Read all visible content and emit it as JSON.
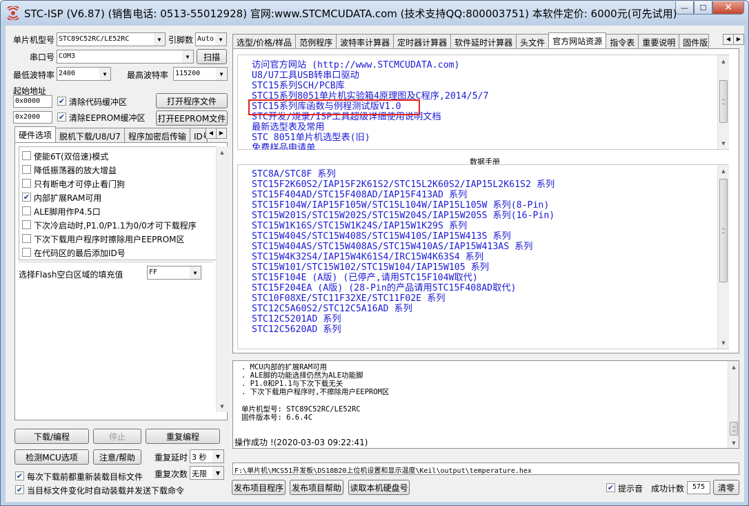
{
  "window": {
    "title": "STC-ISP (V6.87) (销售电话: 0513-55012928) 官网:www.STCMCUDATA.com  (技术支持QQ:800003751) 本软件定价: 6000元(可先试用)",
    "minimize": "—",
    "maximize": "☐",
    "close": "✕"
  },
  "left": {
    "mcu_type_label": "单片机型号",
    "mcu_type_value": "STC89C52RC/LE52RC",
    "pin_count_label": "引脚数",
    "pin_count_value": "Auto",
    "port_label": "串口号",
    "port_value": "COM3",
    "scan_button": "扫描",
    "min_baud_label": "最低波特率",
    "min_baud_value": "2400",
    "max_baud_label": "最高波特率",
    "max_baud_value": "115200",
    "start_addr_label": "起始地址",
    "code_addr": "0x0000",
    "clear_code_label": "清除代码缓冲区",
    "open_program_button": "打开程序文件",
    "eeprom_addr": "0x2000",
    "clear_eeprom_label": "清除EEPROM缓冲区",
    "open_eeprom_button": "打开EEPROM文件",
    "tabs": [
      "硬件选项",
      "脱机下载/U8/U7",
      "程序加密后传输",
      "ID号"
    ],
    "options": [
      {
        "label": "使能6T(双倍速)模式",
        "checked": false
      },
      {
        "label": "降低振荡器的放大增益",
        "checked": false
      },
      {
        "label": "只有断电才可停止看门狗",
        "checked": false
      },
      {
        "label": "内部扩展RAM可用",
        "checked": true
      },
      {
        "label": "ALE脚用作P4.5口",
        "checked": false
      },
      {
        "label": "下次冷启动时,P1.0/P1.1为0/0才可下载程序",
        "checked": false
      },
      {
        "label": "下次下载用户程序时擦除用户EEPROM区",
        "checked": false
      },
      {
        "label": "在代码区的最后添加ID号",
        "checked": false
      }
    ],
    "fill_label": "选择Flash空白区域的填充值",
    "fill_value": "FF",
    "download_button": "下载/编程",
    "stop_button": "停止",
    "redownload_button": "重复编程",
    "check_mcu_button": "检测MCU选项",
    "help_button": "注意/帮助",
    "repeat_delay_label": "重复延时",
    "repeat_delay_value": "3 秒",
    "repeat_count_label": "重复次数",
    "repeat_count_value": "无限",
    "reload_label": "每次下载前都重新装载目标文件",
    "auto_send_label": "当目标文件变化时自动装载并发送下载命令"
  },
  "right": {
    "tabs": [
      "选型/价格/样品",
      "范例程序",
      "波特率计算器",
      "定时器计算器",
      "软件延时计算器",
      "头文件",
      "官方网站资源",
      "指令表",
      "重要说明",
      "固件版"
    ],
    "active_tab": 6,
    "resource_links": [
      "访问官方网站  (http://www.STCMCUDATA.com)",
      "U8/U7工具USB转串口驱动",
      "STC15系列SCH/PCB库",
      "STC15系列8051单片机实验箱4原理图及C程序,2014/5/7",
      "STC15系列库函数与例程测试版V1.0",
      "STC开发/烧录/ISP工具超级详细使用说明文档",
      "最新选型表及常用",
      "STC  8051单片机选型表(旧)",
      "免费样品申请单"
    ],
    "datasheet_header": "数据手册",
    "datasheet_links": [
      "STC8A/STC8F  系列",
      "STC15F2K60S2/IAP15F2K61S2/STC15L2K60S2/IAP15L2K61S2  系列",
      "STC15F404AD/STC15F408AD/IAP15F413AD  系列",
      "STC15F104W/IAP15F105W/STC15L104W/IAP15L105W  系列(8-Pin)",
      "STC15W201S/STC15W202S/STC15W204S/IAP15W205S  系列(16-Pin)",
      "STC15W1K16S/STC15W1K24S/IAP15W1K29S  系列",
      "STC15W404S/STC15W408S/STC15W410S/IAP15W413S  系列",
      "STC15W404AS/STC15W408AS/STC15W410AS/IAP15W413AS  系列",
      "STC15W4K32S4/IAP15W4K61S4/IRC15W4K63S4  系列",
      "STC15W101/STC15W102/STC15W104/IAP15W105  系列",
      "STC15F104E  (A版) (已停产,请用STC15F104W取代)",
      "STC15F204EA  (A版) (28-Pin的产品请用STC15F408AD取代)",
      "STC10F08XE/STC11F32XE/STC11F02E  系列",
      "STC12C5A60S2/STC12C5A16AD  系列",
      "STC12C5201AD  系列",
      "STC12C5620AD  系列"
    ],
    "log_lines": [
      ". MCU内部的扩展RAM可用",
      ". ALE脚的功能选择仍然为ALE功能脚",
      ". P1.0和P1.1与下次下载无关",
      ". 下次下载用户程序时,不擦除用户EEPROM区"
    ],
    "log_mcu": "单片机型号: STC89C52RC/LE52RC",
    "log_firmware": "固件版本号: 6.6.4C",
    "log_result": "操作成功 !(2020-03-03 09:22:41)",
    "file_path": "F:\\单片机\\MCS51开发板\\DS18B20上位机设置和显示温度\\Keil\\output\\temperature.hex",
    "publish_program_button": "发布项目程序",
    "publish_help_button": "发布项目帮助",
    "read_disk_button": "读取本机硬盘号",
    "beep_label": "提示音",
    "success_count_label": "成功计数",
    "success_count_value": "575",
    "clear_button": "清零"
  },
  "colors": {
    "link": "#1a1ad6",
    "highlight_box": "#e0231b"
  }
}
